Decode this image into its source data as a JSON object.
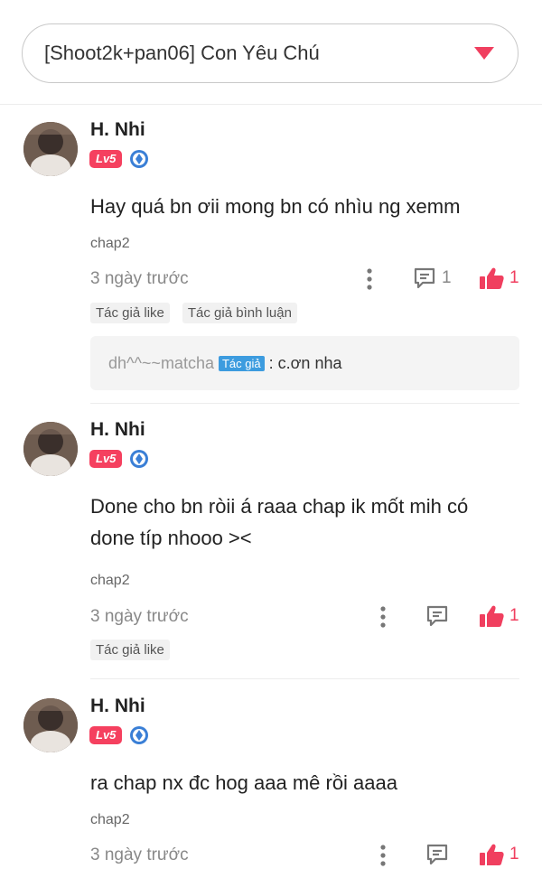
{
  "header": {
    "title": "[Shoot2k+pan06] Con Yêu Chú"
  },
  "comments": [
    {
      "user": "H. Nhi",
      "level": "Lv5",
      "text": "Hay quá bn ơii mong bn có nhìu ng xemm",
      "chapter": "chap2",
      "time": "3 ngày trước",
      "reply_count": "1",
      "like_count": "1",
      "tags": [
        "Tác giả like",
        "Tác giả bình luận"
      ],
      "reply": {
        "user": "dh^^~~matcha",
        "badge": "Tác giả",
        "sep": ":",
        "text": "c.ơn nha"
      }
    },
    {
      "user": "H. Nhi",
      "level": "Lv5",
      "text": "Done cho bn ròii á raaa chap ik mốt mih có done típ nhooo ><",
      "chapter": "chap2",
      "time": "3 ngày trước",
      "like_count": "1",
      "tags": [
        "Tác giả like"
      ]
    },
    {
      "user": "H. Nhi",
      "level": "Lv5",
      "text": "ra chap nx đc hog aaa mê rồi aaaa",
      "chapter": "chap2",
      "time": "3 ngày trước",
      "like_count": "1"
    }
  ],
  "colors": {
    "accent": "#f03f5f",
    "level_badge": "#f5405f",
    "author_badge": "#3d9cdf",
    "medal": "#3a7fd6"
  },
  "icons": [
    "dropdown-caret-icon",
    "medal-icon",
    "more-vertical-icon",
    "comment-icon",
    "thumbs-up-icon"
  ]
}
